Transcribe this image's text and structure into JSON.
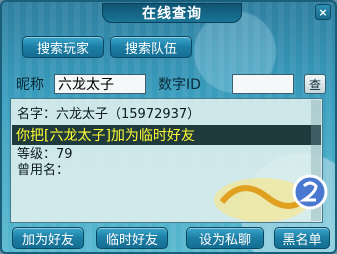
{
  "window": {
    "title": "在线查询",
    "close_label": "×"
  },
  "search_tabs": {
    "players_label": "搜索玩家",
    "teams_label": "搜索队伍"
  },
  "fields": {
    "nickname_label": "昵称",
    "nickname_value": "六龙太子",
    "digit_id_label": "数字ID",
    "digit_id_value": "",
    "search_button_label": "查"
  },
  "result": {
    "name_line": "名字：六龙太子（15972937）",
    "highlight_line": "你把[六龙太子]加为临时好友",
    "level_line": "等级：79",
    "former_name_line": "曾用名："
  },
  "actions": {
    "add_friend": "加为好友",
    "temp_friend": "临时好友",
    "private_chat": "设为私聊",
    "blacklist": "黑名单"
  },
  "colors": {
    "highlight_bg": "#1f3a3c",
    "highlight_text": "#ffff33",
    "frame": "#2f7fa0"
  }
}
